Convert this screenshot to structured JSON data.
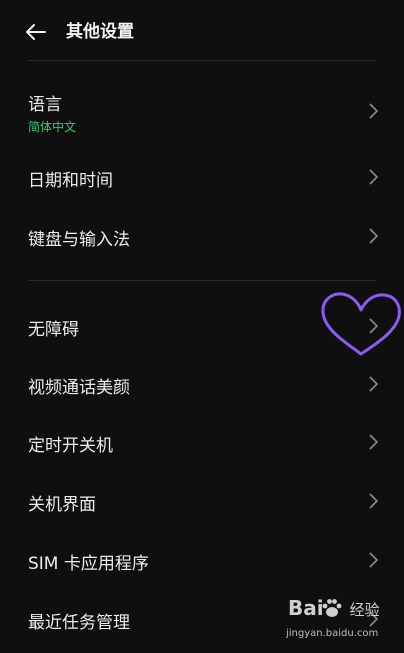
{
  "header": {
    "title": "其他设置"
  },
  "items": [
    {
      "label": "语言",
      "sub": "简体中文"
    },
    {
      "label": "日期和时间"
    },
    {
      "label": "键盘与输入法"
    },
    {
      "label": "无障碍"
    },
    {
      "label": "视频通话美颜"
    },
    {
      "label": "定时开关机"
    },
    {
      "label": "关机界面"
    },
    {
      "label": "SIM 卡应用程序"
    },
    {
      "label": "最近任务管理"
    }
  ],
  "watermark": {
    "logo_left": "Bai",
    "logo_right": "经验",
    "url": "jingyan.baidu.com"
  },
  "colors": {
    "background": "#0f0f10",
    "accent": "#2fce70",
    "heart": "#8a5cf0"
  }
}
